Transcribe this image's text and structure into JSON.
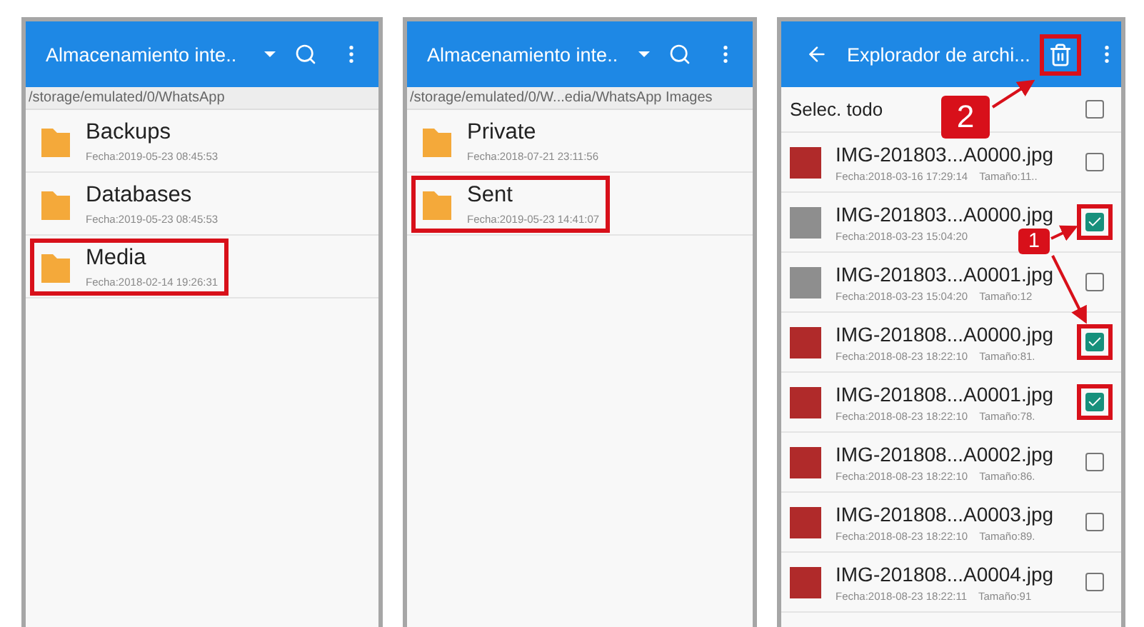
{
  "panels": [
    {
      "kind": "folders",
      "title": "Almacenamiento inte..",
      "path": "/storage/emulated/0/WhatsApp",
      "items": [
        {
          "name": "Backups",
          "date": "Fecha:2019-05-23 08:45:53",
          "highlighted": false
        },
        {
          "name": "Databases",
          "date": "Fecha:2019-05-23 08:45:53",
          "highlighted": false
        },
        {
          "name": "Media",
          "date": "Fecha:2018-02-14 19:26:31",
          "highlighted": true
        }
      ]
    },
    {
      "kind": "folders",
      "title": "Almacenamiento inte..",
      "path": "/storage/emulated/0/W...edia/WhatsApp Images",
      "items": [
        {
          "name": "Private",
          "date": "Fecha:2018-07-21 23:11:56",
          "highlighted": false
        },
        {
          "name": "Sent",
          "date": "Fecha:2019-05-23 14:41:07",
          "highlighted": true
        }
      ]
    },
    {
      "kind": "files",
      "title": "Explorador de archi...",
      "delete_highlighted": true,
      "select_all": {
        "label": "Selec. todo",
        "checked": false
      },
      "files": [
        {
          "name": "IMG-201803...A0000.jpg",
          "date": "Fecha:2018-03-16 17:29:14",
          "size": "Tamaño:11..",
          "kind": "photo",
          "checked": false,
          "highlighted": false
        },
        {
          "name": "IMG-201803...A0000.jpg",
          "date": "Fecha:2018-03-23 15:04:20",
          "kind": "blank",
          "checked": true,
          "highlighted": true
        },
        {
          "name": "IMG-201803...A0001.jpg",
          "date": "Fecha:2018-03-23 15:04:20",
          "size": "Tamaño:12",
          "kind": "blank",
          "checked": false,
          "highlighted": false
        },
        {
          "name": "IMG-201808...A0000.jpg",
          "date": "Fecha:2018-08-23 18:22:10",
          "size": "Tamaño:81.",
          "kind": "photo",
          "checked": true,
          "highlighted": true
        },
        {
          "name": "IMG-201808...A0001.jpg",
          "date": "Fecha:2018-08-23 18:22:10",
          "size": "Tamaño:78.",
          "kind": "photo",
          "checked": true,
          "highlighted": true
        },
        {
          "name": "IMG-201808...A0002.jpg",
          "date": "Fecha:2018-08-23 18:22:10",
          "size": "Tamaño:86.",
          "kind": "photo",
          "checked": false,
          "highlighted": false
        },
        {
          "name": "IMG-201808...A0003.jpg",
          "date": "Fecha:2018-08-23 18:22:10",
          "size": "Tamaño:89.",
          "kind": "photo",
          "checked": false,
          "highlighted": false
        },
        {
          "name": "IMG-201808...A0004.jpg",
          "date": "Fecha:2018-08-23 18:22:11",
          "size": "Tamaño:91",
          "kind": "photo",
          "checked": false,
          "highlighted": false
        }
      ]
    }
  ],
  "annotations": [
    {
      "label": "2"
    },
    {
      "label": "1"
    }
  ]
}
